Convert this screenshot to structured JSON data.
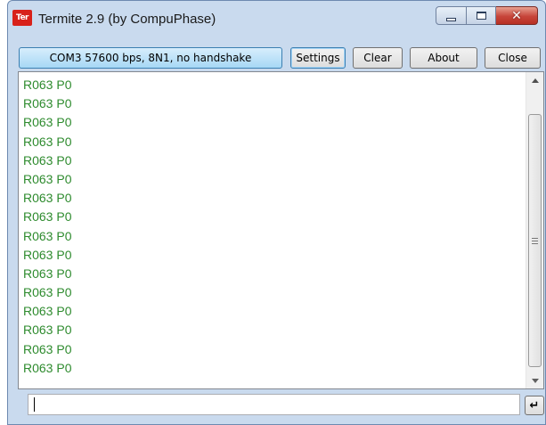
{
  "window": {
    "title": "Termite 2.9 (by CompuPhase)",
    "logo_text": "Ter",
    "controls": {
      "minimize_icon": "minimize-icon",
      "maximize_icon": "maximize-icon",
      "close_icon": "close-icon",
      "close_glyph": "✕"
    }
  },
  "toolbar": {
    "port_status": "COM3 57600 bps, 8N1, no handshake",
    "settings_label": "Settings",
    "clear_label": "Clear",
    "about_label": "About",
    "close_label": "Close"
  },
  "terminal": {
    "text_color": "#2e8b2e",
    "lines": [
      "R063 P0",
      "R063 P0",
      "R063 P0",
      "R063 P0",
      "R063 P0",
      "R063 P0",
      "R063 P0",
      "R063 P0",
      "R063 P0",
      "R063 P0",
      "R063 P0",
      "R063 P0",
      "R063 P0",
      "R063 P0",
      "R063 P0",
      "R063 P0"
    ]
  },
  "input": {
    "value": "",
    "send_icon": "enter-icon",
    "send_glyph": "↵"
  },
  "colors": {
    "accent": "#3c7fb1",
    "close_button": "#c7453a",
    "window_frame": "#c9daee"
  }
}
